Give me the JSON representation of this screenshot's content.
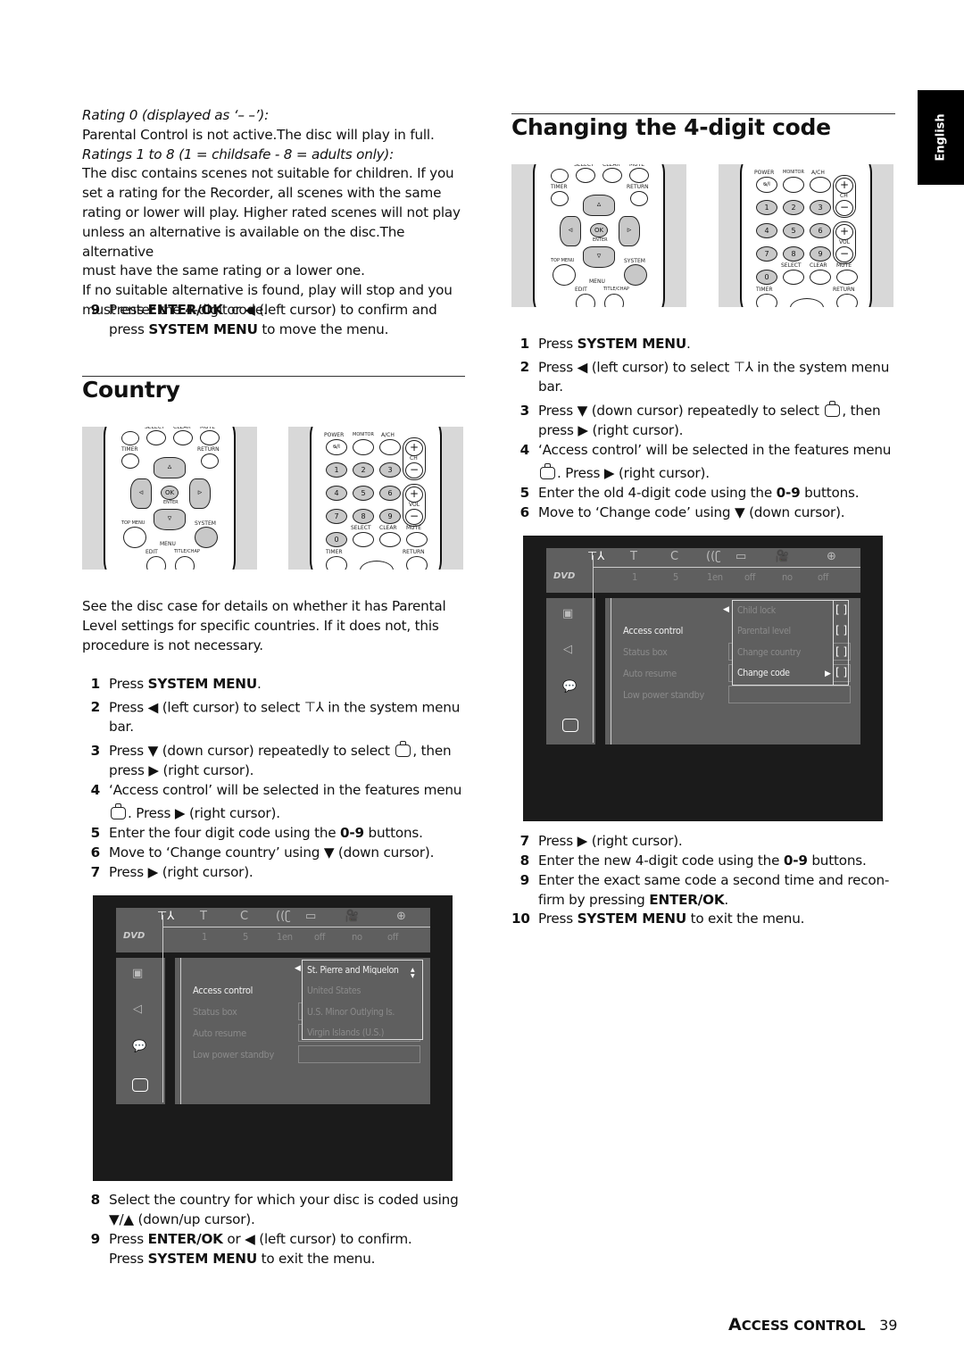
{
  "side_tab": {
    "language": "English"
  },
  "left_column": {
    "intro": [
      {
        "style": "italic",
        "text": "Rating 0 (displayed as ‘– –’):"
      },
      {
        "style": "normal",
        "text": "Parental Control is not active.The disc will play in full."
      },
      {
        "style": "italic",
        "text": "Ratings 1 to 8 (1 = childsafe - 8 = adults only):"
      },
      {
        "style": "normal",
        "text": "The disc contains scenes not suitable for children. If you"
      },
      {
        "style": "normal",
        "text": "set a rating for the Recorder, all scenes with the same"
      },
      {
        "style": "normal",
        "text": "rating or lower will play. Higher rated scenes will not play"
      },
      {
        "style": "normal",
        "text": "unless an alternative is available on the disc.The alternative"
      },
      {
        "style": "normal",
        "text": "must have the same rating or a lower one."
      },
      {
        "style": "normal",
        "text": "If no suitable alternative is found, play will stop and you"
      },
      {
        "style": "normal",
        "text": "must enter the 4-digit code."
      }
    ],
    "step9_prev": {
      "num": "9",
      "line1_a": "Press ",
      "line1_b": "ENTER/OK",
      "line1_c": " or ◀ (left cursor) to confirm and",
      "line2_a": "press ",
      "line2_b": "SYSTEM MENU",
      "line2_c": " to move the menu."
    },
    "country_heading": "Country",
    "country_intro": [
      "See the disc case for details on whether it has Parental",
      "Level settings for specific countries. If it does not, this",
      "procedure is not necessary."
    ],
    "steps": {
      "s1": {
        "num": "1",
        "a": "Press ",
        "b": "SYSTEM MENU",
        "c": "."
      },
      "s2": {
        "num": "2",
        "a": "Press ◀  (left cursor) to select ",
        "c": " in the system menu",
        "d": "bar."
      },
      "s3": {
        "num": "3",
        "a": "Press ▼ (down cursor) repeatedly to select ",
        "c": ", then",
        "d": "press ▶ (right cursor)."
      },
      "s4": {
        "num": "4",
        "a": "‘Access control’ will be selected in the features menu",
        "d": ". Press ▶ (right cursor)."
      },
      "s5": {
        "num": "5",
        "a": "Enter the four digit code using the ",
        "b": "0-9",
        "c": " buttons."
      },
      "s6": {
        "num": "6",
        "a": "Move to ‘Change country’ using ▼ (down cursor)."
      },
      "s7": {
        "num": "7",
        "a": "Press ▶ (right cursor)."
      },
      "s8": {
        "num": "8",
        "a": "Select the country for which your disc is coded using",
        "d": "▼/▲ (down/up cursor)."
      },
      "s9": {
        "num": "9",
        "a": "Press ",
        "b": "ENTER/OK",
        "c": " or ◀ (left cursor) to confirm.",
        "d_a": "Press ",
        "d_b": "SYSTEM MENU",
        "d_c": " to exit the menu."
      }
    },
    "osd": {
      "menu_values": [
        "1",
        "5",
        "1en",
        "off",
        "no",
        "off"
      ],
      "features": [
        "Access control",
        "Status box",
        "Auto resume",
        "Low power standby"
      ],
      "dropdown": [
        "St. Pierre and Miquelon",
        "United States",
        "U.S. Minor Outlying Is.",
        "Virgin Islands (U.S.)"
      ]
    }
  },
  "right_column": {
    "heading": "Changing the 4-digit code",
    "steps": {
      "s1": {
        "num": "1",
        "a": "Press ",
        "b": "SYSTEM MENU",
        "c": "."
      },
      "s2": {
        "num": "2",
        "a": "Press ◀  (left cursor) to select ",
        "c": " in the system menu",
        "d": "bar."
      },
      "s3": {
        "num": "3",
        "a": "Press ▼ (down cursor) repeatedly to select ",
        "c": ", then",
        "d": "press ▶ (right cursor)."
      },
      "s4": {
        "num": "4",
        "a": "‘Access control’ will be selected in the features menu",
        "d": ". Press ▶ (right cursor)."
      },
      "s5": {
        "num": "5",
        "a": "Enter the old 4-digit code using the ",
        "b": "0-9",
        "c": " buttons."
      },
      "s6": {
        "num": "6",
        "a": "Move to ‘Change code’ using ▼ (down cursor)."
      },
      "s7": {
        "num": "7",
        "a": "Press ▶ (right cursor)."
      },
      "s8": {
        "num": "8",
        "a": "Enter the new 4-digit code using the ",
        "b": "0-9",
        "c": " buttons."
      },
      "s9": {
        "num": "9",
        "a": "Enter the exact same code a second time and recon-",
        "d_a": "firm by pressing ",
        "d_b": "ENTER/OK",
        "d_c": "."
      },
      "s10": {
        "num": "10",
        "a": "Press ",
        "b": "SYSTEM MENU",
        "c": " to exit the menu."
      }
    },
    "osd": {
      "menu_values": [
        "1",
        "5",
        "1en",
        "off",
        "no",
        "off"
      ],
      "features": [
        "Access control",
        "Status box",
        "Auto resume",
        "Low power standby"
      ],
      "dropdown": [
        "Child lock",
        "Parental level",
        "Change country",
        "Change code"
      ]
    }
  },
  "remote": {
    "row_top": [
      "SELECT",
      "CLEAR",
      "MUTE"
    ],
    "timer": "TIMER",
    "return": "RETURN",
    "ok": "OK",
    "enter": "ENTER",
    "top_menu": "TOP MENU",
    "system": "SYSTEM",
    "menu": "MENU",
    "edit": "EDIT",
    "title_chap": "TITLE/CHAP",
    "power": "POWER",
    "power_sym": "ᴓ/I",
    "monitor": "MONITOR",
    "ach": "A/CH",
    "ch": "CH",
    "vol": "VOL",
    "digits": [
      "1",
      "2",
      "3",
      "4",
      "5",
      "6",
      "7",
      "8",
      "9",
      "0"
    ],
    "plus": "+",
    "minus": "−"
  },
  "footer": {
    "section_cap": "A",
    "section_rest": "CCESS CONTROL",
    "page": "39"
  }
}
